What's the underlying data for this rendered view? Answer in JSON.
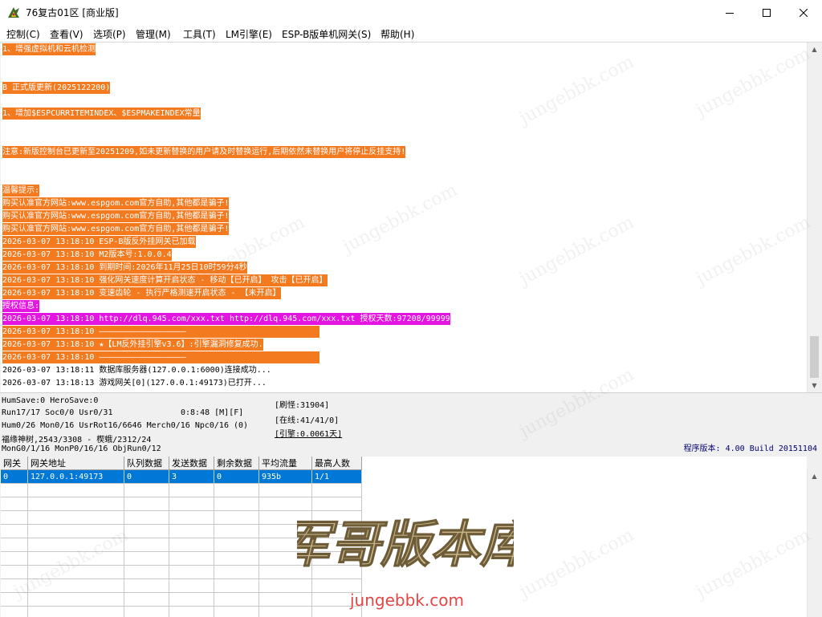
{
  "window": {
    "title": "76复古01区 [商业版]",
    "icon": "app-icon",
    "controls": {
      "minimize": "minimize-icon",
      "maximize": "maximize-icon",
      "close": "close-icon"
    }
  },
  "menu": [
    {
      "id": "control",
      "label": "控制(C)"
    },
    {
      "id": "view",
      "label": "查看(V)"
    },
    {
      "id": "options",
      "label": "选项(P)"
    },
    {
      "id": "manage",
      "label": "管理(M)"
    },
    {
      "id": "tools",
      "label": "工具(T)"
    },
    {
      "id": "lm-engine",
      "label": "LM引擎(E)"
    },
    {
      "id": "espb-gateway",
      "label": "ESP-B版单机网关(S)"
    },
    {
      "id": "help",
      "label": "帮助(H)"
    }
  ],
  "log": {
    "lines": [
      {
        "text": "1、增强虚拟机和云机检测",
        "style": "orange"
      },
      {
        "text": "B 正式版更新(2025122200)",
        "style": "orange"
      },
      {
        "text": "1、增加$ESPCURRITEMINDEX、$ESPMAKEINDEX常量",
        "style": "orange"
      },
      {
        "text": "注意:新版控制台已更新至20251209,如未更新替换的用户请及时替换运行,后期依然未替换用户将停止反挂支持!",
        "style": "orange"
      },
      {
        "text": "温馨提示:",
        "style": "orange"
      },
      {
        "text": "购买认准官方网站:www.espgom.com官方自助,其他都是骗子!",
        "style": "orange"
      },
      {
        "text": "购买认准官方网站:www.espgom.com官方自助,其他都是骗子!",
        "style": "orange"
      },
      {
        "text": "购买认准官方网站:www.espgom.com官方自助,其他都是骗子!",
        "style": "orange"
      },
      {
        "text": "2026-03-07 13:18:10 ESP-B版反外挂网关已加载",
        "style": "orange"
      },
      {
        "text": "2026-03-07 13:18:10 M2版本号:1.0.0.4",
        "style": "orange"
      },
      {
        "text": "2026-03-07 13:18:10 到期时间:2026年11月25日10时59分4秒",
        "style": "orange"
      },
      {
        "text": "2026-03-07 13:18:10 强化网关速度计算开启状态 - 移动【已开启】 攻击【已开启】",
        "style": "orange"
      },
      {
        "text": "2026-03-07 13:18:10 变速齿轮 - 执行严格测速开启状态 - 【未开启】",
        "style": "orange"
      },
      {
        "text": "授权信息:",
        "style": "magenta"
      },
      {
        "text": "2026-03-07 13:18:10 http://dlq.945.com/xxx.txt http://dlq.945.com/xxx.txt 授权天数:97208/99999",
        "style": "magenta"
      },
      {
        "text": "2026-03-07 13:18:10 ——————————————————",
        "style": "orange"
      },
      {
        "text": "2026-03-07 13:18:10 ★【LM反外挂引擎v3.6】:引擎漏洞修复成功.",
        "style": "orange"
      },
      {
        "text": "2026-03-07 13:18:10 ——————————————————",
        "style": "orange"
      },
      {
        "text": "2026-03-07 13:18:11 数据库服务器(127.0.0.1:6000)连接成功...",
        "style": "plain"
      },
      {
        "text": "2026-03-07 13:18:13 游戏网关[0](127.0.0.1:49173)已打开...",
        "style": "plain"
      }
    ]
  },
  "status": {
    "line1": "HumSave:0 HeroSave:0",
    "line2a": "Run17/17 Soc0/0 Usr0/31",
    "line2b": "0:8:48 [M][F]",
    "line3": "Hum0/26 Mon0/16 UsrRot16/6646 Merch0/16 Npc0/16 (0)",
    "line4": "福缘神树,2543/3308 - 楔蛾/2312/24",
    "line5": "MonG0/1/16 MonP0/16/16 ObjRun0/12",
    "refresh": "[刷怪:31904]",
    "online": "[在线:41/41/0]",
    "engine": "[引擎:0.0061天]",
    "version": "程序版本: 4.00 Build 20151104"
  },
  "gateway_table": {
    "columns": [
      "网关",
      "网关地址",
      "队列数据",
      "发送数据",
      "剩余数据",
      "平均流量",
      "最高人数"
    ],
    "rows": [
      [
        "0",
        "127.0.0.1:49173",
        "0",
        "3",
        "0",
        "935b",
        "1/1"
      ],
      [
        "",
        "",
        "",
        "",
        "",
        "",
        ""
      ],
      [
        "",
        "",
        "",
        "",
        "",
        "",
        ""
      ],
      [
        "",
        "",
        "",
        "",
        "",
        "",
        ""
      ],
      [
        "",
        "",
        "",
        "",
        "",
        "",
        ""
      ],
      [
        "",
        "",
        "",
        "",
        "",
        "",
        ""
      ],
      [
        "",
        "",
        "",
        "",
        "",
        "",
        ""
      ],
      [
        "",
        "",
        "",
        "",
        "",
        "",
        ""
      ],
      [
        "",
        "",
        "",
        "",
        "",
        "",
        ""
      ],
      [
        "",
        "",
        "",
        "",
        "",
        "",
        ""
      ],
      [
        "",
        "",
        "",
        "",
        "",
        "",
        ""
      ]
    ]
  },
  "watermark": {
    "text": "jungebbk.com",
    "logo_text": "军哥版本库",
    "logo_url": "jungebbk.com"
  },
  "colors": {
    "log_orange": "#f47a20",
    "log_magenta": "#e415e0",
    "selection": "#0078d7",
    "version_text": "#00006e",
    "watermark_url": "#e64545"
  }
}
